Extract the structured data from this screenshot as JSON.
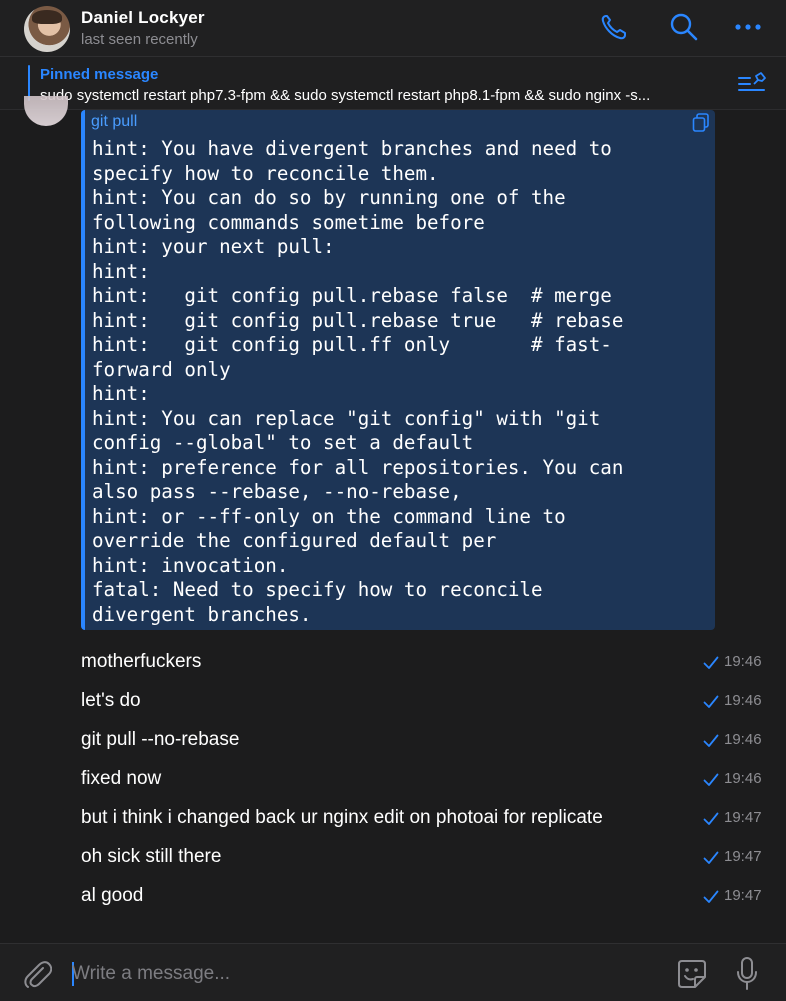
{
  "header": {
    "contact_name": "Daniel Lockyer",
    "contact_status": "last seen recently",
    "icons": [
      "phone-icon",
      "search-icon",
      "more-icon"
    ]
  },
  "pinned": {
    "title": "Pinned message",
    "text": "sudo systemctl restart php7.3-fpm && sudo systemctl restart php8.1-fpm && sudo nginx -s..."
  },
  "code_message": {
    "language": "git pull",
    "code": "hint: You have divergent branches and need to\nspecify how to reconcile them.\nhint: You can do so by running one of the\nfollowing commands sometime before\nhint: your next pull:\nhint:\nhint:   git config pull.rebase false  # merge\nhint:   git config pull.rebase true   # rebase\nhint:   git config pull.ff only       # fast-\nforward only\nhint:\nhint: You can replace \"git config\" with \"git\nconfig --global\" to set a default\nhint: preference for all repositories. You can\nalso pass --rebase, --no-rebase,\nhint: or --ff-only on the command line to\noverride the configured default per\nhint: invocation.\nfatal: Need to specify how to reconcile\ndivergent branches."
  },
  "messages": [
    {
      "text": "motherfuckers",
      "time": "19:46"
    },
    {
      "text": "let's do",
      "time": "19:46"
    },
    {
      "text": "git pull --no-rebase",
      "time": "19:46"
    },
    {
      "text": "fixed now",
      "time": "19:46"
    },
    {
      "text": "but i think i changed back ur nginx edit on photoai for replicate",
      "time": "19:47"
    },
    {
      "text": "oh sick still there",
      "time": "19:47"
    },
    {
      "text": "al good",
      "time": "19:47"
    }
  ],
  "composer": {
    "placeholder": "Write a message..."
  },
  "colors": {
    "accent": "#2a86ff",
    "background": "#1c1c1d",
    "code_background": "#1d3556"
  }
}
